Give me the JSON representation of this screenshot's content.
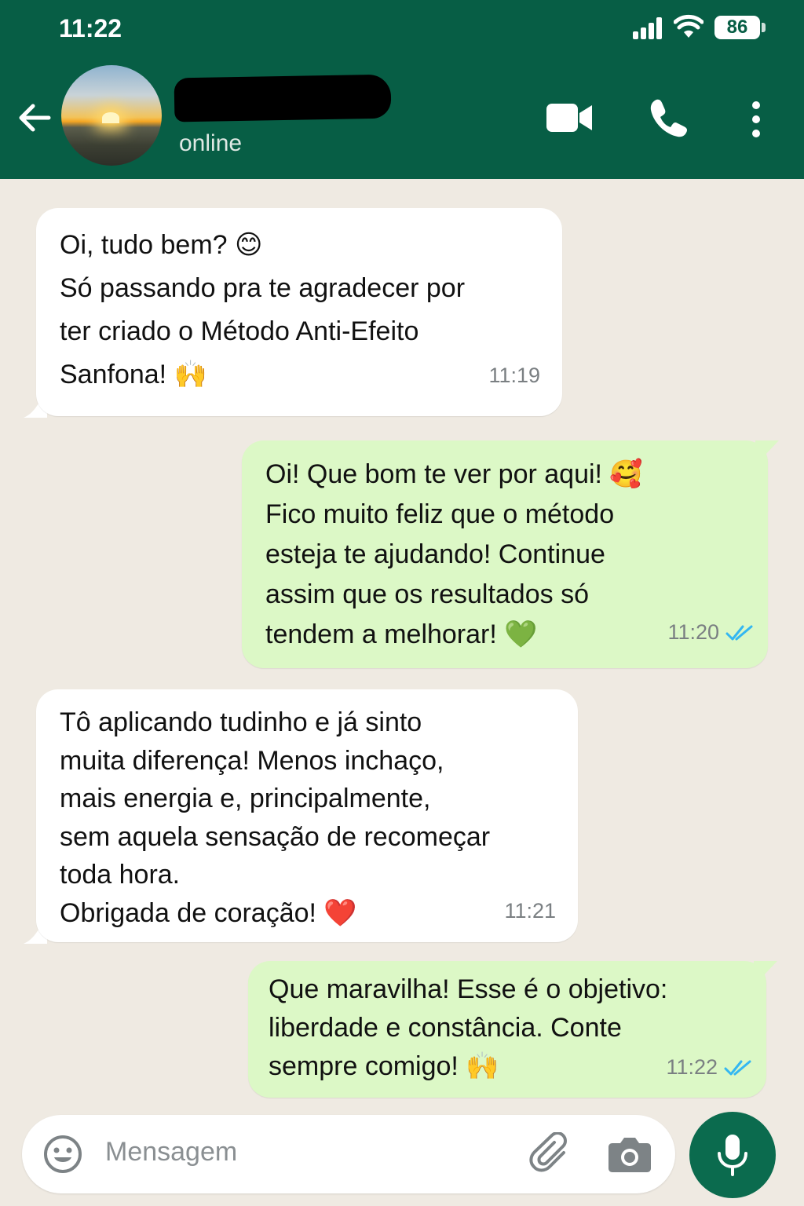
{
  "status_bar": {
    "time": "11:22",
    "battery": "86"
  },
  "header": {
    "presence": "online",
    "icons": [
      "back-arrow-icon",
      "video-call-icon",
      "phone-icon",
      "more-vert-icon"
    ]
  },
  "messages": [
    {
      "direction": "incoming",
      "text": "Oi, tudo bem? 😊\nSó passando pra te agradecer por\nter criado o Método Anti-Efeito\nSanfona! 🙌",
      "time": "11:19"
    },
    {
      "direction": "outgoing",
      "text": "Oi! Que bom te ver por aqui! 🥰\nFico muito feliz que o método\nesteja te ajudando! Continue\nassim que os resultados só\ntendem a melhorar! 💚",
      "time": "11:20",
      "read": true
    },
    {
      "direction": "incoming",
      "text": "Tô aplicando tudinho e já sinto\nmuita diferença! Menos inchaço,\nmais energia e, principalmente,\nsem aquela sensação de recomeçar\ntoda hora.\nObrigada de coração! ❤️",
      "time": "11:21"
    },
    {
      "direction": "outgoing",
      "text": "Que maravilha! Esse é o objetivo:\nliberdade e constância. Conte\nsempre comigo! 🙌",
      "time": "11:22",
      "read": true
    }
  ],
  "composer": {
    "placeholder": "Mensagem",
    "icons": [
      "emoji-icon",
      "attach-icon",
      "camera-icon",
      "mic-icon"
    ]
  },
  "colors": {
    "header": "#075e45",
    "chat_background": "#efeae2",
    "incoming_bubble": "#ffffff",
    "outgoing_bubble": "#dcf8c6",
    "read_ticks": "#34b7f1",
    "mic_button": "#0b6b4e"
  }
}
